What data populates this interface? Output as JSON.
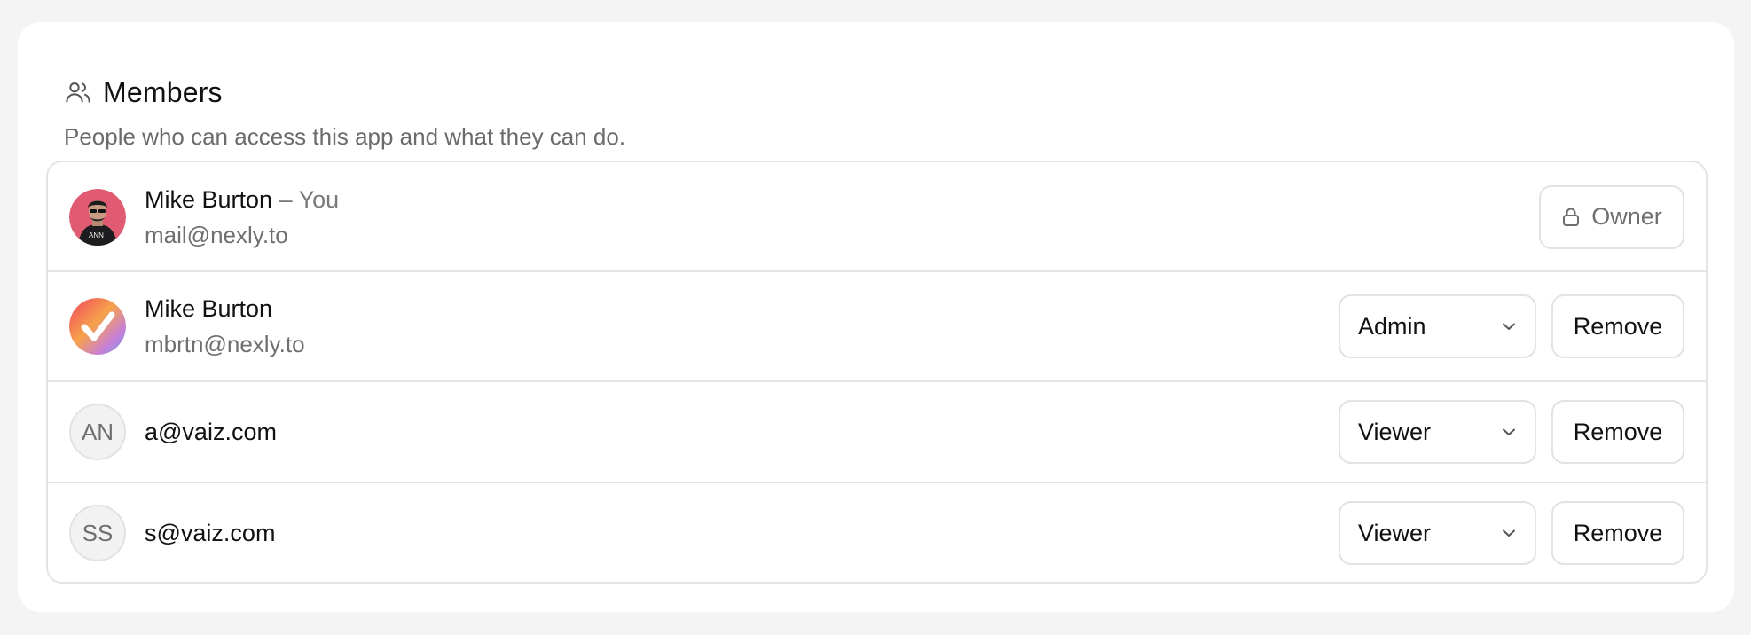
{
  "section": {
    "title": "Members",
    "subtitle": "People who can access this app and what they can do.",
    "icon": "users-icon"
  },
  "members": [
    {
      "name": "Mike Burton",
      "you_suffix": "– You",
      "email": "mail@nexly.to",
      "role": "Owner",
      "role_icon": "lock-icon",
      "avatar": "photo"
    },
    {
      "name": "Mike Burton",
      "email": "mbrtn@nexly.to",
      "role": "Admin",
      "remove_label": "Remove",
      "avatar": "checkmark-logo"
    },
    {
      "initials": "AN",
      "email": "a@vaiz.com",
      "role": "Viewer",
      "remove_label": "Remove"
    },
    {
      "initials": "SS",
      "email": "s@vaiz.com",
      "role": "Viewer",
      "remove_label": "Remove"
    }
  ],
  "colors": {
    "page_bg": "#f4f4f4",
    "card_bg": "#ffffff",
    "border": "#e4e4e4",
    "muted_text": "#6f6f6f"
  }
}
